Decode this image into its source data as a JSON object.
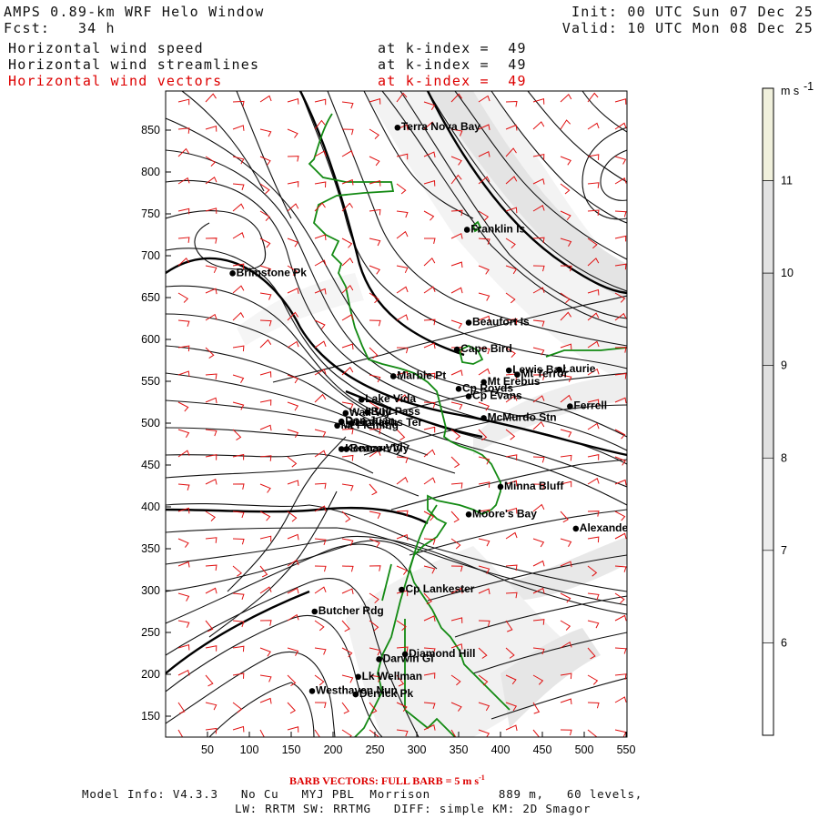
{
  "header": {
    "title": "AMPS 0.89-km WRF Helo Window",
    "forecast": "Fcst:   34 h",
    "init": "Init: 00 UTC Sun 07 Dec 25",
    "valid": "Valid: 10 UTC Mon 08 Dec 25",
    "fields": [
      {
        "label": "Horizontal wind speed",
        "level": "at k-index =  49",
        "color": "#111111"
      },
      {
        "label": "Horizontal wind streamlines",
        "level": "at k-index =  49",
        "color": "#111111"
      },
      {
        "label": "Horizontal wind vectors",
        "level": "at k-index =  49",
        "color": "#dd0000"
      }
    ]
  },
  "axes": {
    "x_ticks": [
      "50",
      "100",
      "150",
      "200",
      "250",
      "300",
      "350",
      "400",
      "450",
      "500",
      "550"
    ],
    "y_ticks": [
      "850",
      "800",
      "750",
      "700",
      "650",
      "600",
      "550",
      "500",
      "450",
      "400",
      "350",
      "300",
      "250",
      "200",
      "150"
    ]
  },
  "colorbar": {
    "units": "m s",
    "units_exp": "-1",
    "labels": [
      "11",
      "10",
      "9",
      "8",
      "7",
      "6"
    ],
    "colors": [
      "#f0f0dc",
      "#e3e3e3",
      "#d6d6d6",
      "#e0e0e0",
      "#ececec",
      "#f6f6f6"
    ]
  },
  "places": [
    {
      "name": "Terra Nova Bay",
      "x": 277,
      "y": 853
    },
    {
      "name": "Franklin Is",
      "x": 360,
      "y": 731
    },
    {
      "name": "Brimstone Pk",
      "x": 80,
      "y": 679
    },
    {
      "name": "Beaufort Is",
      "x": 362,
      "y": 620
    },
    {
      "name": "Cape Bird",
      "x": 348,
      "y": 588
    },
    {
      "name": "Lewis Bay",
      "x": 410,
      "y": 563
    },
    {
      "name": "Laurie",
      "x": 470,
      "y": 564
    },
    {
      "name": "Mt Terror",
      "x": 420,
      "y": 558
    },
    {
      "name": "Marble Pt",
      "x": 272,
      "y": 556
    },
    {
      "name": "Mt Erebus",
      "x": 380,
      "y": 549
    },
    {
      "name": "Cp Royds",
      "x": 350,
      "y": 541
    },
    {
      "name": "Lake Vida",
      "x": 234,
      "y": 528
    },
    {
      "name": "Cp Evans",
      "x": 362,
      "y": 532
    },
    {
      "name": "Ferrell",
      "x": 483,
      "y": 520
    },
    {
      "name": "Wall Vly",
      "x": 215,
      "y": 512
    },
    {
      "name": "Bull Pass",
      "x": 241,
      "y": 513
    },
    {
      "name": "McMurdo Stn",
      "x": 380,
      "y": 506
    },
    {
      "name": "Don Juan",
      "x": 210,
      "y": 502
    },
    {
      "name": "Mt Fleming",
      "x": 205,
      "y": 497
    },
    {
      "name": "Linnaeus Ter",
      "x": 222,
      "y": 500
    },
    {
      "name": "Kennar Vly",
      "x": 210,
      "y": 469
    },
    {
      "name": "Beacon Vly",
      "x": 216,
      "y": 469
    },
    {
      "name": "Minna Bluff",
      "x": 400,
      "y": 424
    },
    {
      "name": "Moore's Bay",
      "x": 362,
      "y": 391
    },
    {
      "name": "Alexander",
      "x": 490,
      "y": 374
    },
    {
      "name": "Cp Lankester",
      "x": 282,
      "y": 301
    },
    {
      "name": "Butcher Rdg",
      "x": 178,
      "y": 275
    },
    {
      "name": "Diamond Hill",
      "x": 286,
      "y": 224
    },
    {
      "name": "Darwin Gl",
      "x": 255,
      "y": 218
    },
    {
      "name": "Lk Wellman",
      "x": 230,
      "y": 197
    },
    {
      "name": "Westhaven Nun",
      "x": 175,
      "y": 180
    },
    {
      "name": "Derrick Pk",
      "x": 227,
      "y": 176
    }
  ],
  "footer": {
    "barb_note": "BARB VECTORS:  FULL BARB = 5 m s",
    "barb_exp": "-1",
    "model_info": "Model Info: V4.3.3   No Cu   MYJ PBL  Morrison         889 m,   60 levels,",
    "physics": "LW: RRTM SW: RRTMG   DIFF: simple KM: 2D Smagor"
  }
}
